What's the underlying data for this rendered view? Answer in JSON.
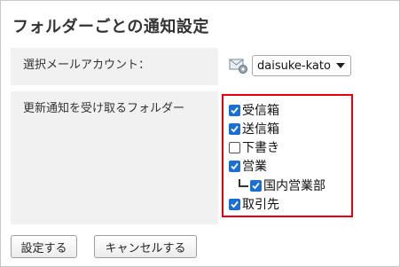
{
  "page": {
    "title": "フォルダーごとの通知設定"
  },
  "form": {
    "account_label": "選択メールアカウント：",
    "account_value": "daisuke-kato",
    "folders_label": "更新通知を受け取るフォルダー"
  },
  "folders": [
    {
      "name": "受信箱",
      "checked": true,
      "level": 0
    },
    {
      "name": "送信箱",
      "checked": true,
      "level": 0
    },
    {
      "name": "下書き",
      "checked": false,
      "level": 0
    },
    {
      "name": "営業",
      "checked": true,
      "level": 0
    },
    {
      "name": "国内営業部",
      "checked": true,
      "level": 1
    },
    {
      "name": "取引先",
      "checked": true,
      "level": 0
    }
  ],
  "buttons": {
    "save_label": "設定する",
    "cancel_label": "キャンセルする"
  },
  "colors": {
    "highlight_border": "#e60012",
    "checkbox_checked": "#1a6fd6",
    "label_background": "#f1f1f1"
  }
}
